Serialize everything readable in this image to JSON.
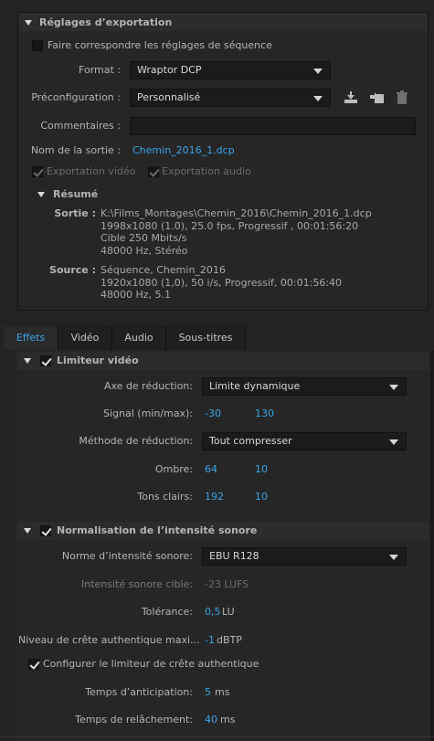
{
  "export_settings": {
    "section_title": "Réglages d’exportation",
    "match_sequence_label": "Faire correspondre les réglages de séquence",
    "format_label": "Format :",
    "format_value": "Wraptor DCP",
    "preset_label": "Préconfiguration :",
    "preset_value": "Personnalisé",
    "comments_label": "Commentaires :",
    "comments_value": "",
    "output_name_label": "Nom de la sortie :",
    "output_name_value": "Chemin_2016_1.dcp",
    "export_video_label": "Exportation vidéo",
    "export_audio_label": "Exportation audio"
  },
  "summary": {
    "title": "Résumé",
    "output_key": "Sortie :",
    "output_lines": [
      "K:\\Films_Montages\\Chemin_2016\\Chemin_2016_1.dcp",
      "1998x1080 (1.0), 25.0 fps, Progressif , 00:01:56:20",
      "Cible 250 Mbits/s",
      "48000 Hz, Stéréo"
    ],
    "source_key": "Source :",
    "source_lines": [
      "Séquence, Chemin_2016",
      "1920x1080 (1,0), 50  i/s, Progressif, 00:01:56:40",
      "48000 Hz, 5.1"
    ]
  },
  "tabs": [
    {
      "label": "Effets",
      "active": true
    },
    {
      "label": "Vidéo",
      "active": false
    },
    {
      "label": "Audio",
      "active": false
    },
    {
      "label": "Sous-titres",
      "active": false
    }
  ],
  "video_limiter": {
    "title": "Limiteur vidéo",
    "reduction_axis_label": "Axe de réduction:",
    "reduction_axis_value": "Limite dynamique",
    "signal_label": "Signal (min/max):",
    "signal_min": "-30",
    "signal_max": "130",
    "reduction_method_label": "Méthode de réduction:",
    "reduction_method_value": "Tout compresser",
    "shadow_label": "Ombre:",
    "shadow_a": "64",
    "shadow_b": "10",
    "highlights_label": "Tons clairs:",
    "highlights_a": "192",
    "highlights_b": "10"
  },
  "loudness": {
    "title": "Normalisation de l’intensité sonore",
    "standard_label": "Norme d’intensité sonore:",
    "standard_value": "EBU R128",
    "target_label": "Intensité sonore cible:",
    "target_value": "-23 LUFS",
    "tolerance_label": "Tolérance:",
    "tolerance_value": "0,5",
    "tolerance_unit": "LU",
    "peak_label": "Niveau de crête authentique maxi...",
    "peak_value": "-1",
    "peak_unit": "dBTP",
    "configure_peak_label": "Configurer le limiteur de crête authentique",
    "lookahead_label": "Temps d’anticipation:",
    "lookahead_value": "5",
    "lookahead_unit": "ms",
    "release_label": "Temps de relâchement:",
    "release_value": "40",
    "release_unit": "ms"
  },
  "colors": {
    "accent": "#3aa4e6",
    "background": "#232323",
    "panel": "#262626"
  }
}
